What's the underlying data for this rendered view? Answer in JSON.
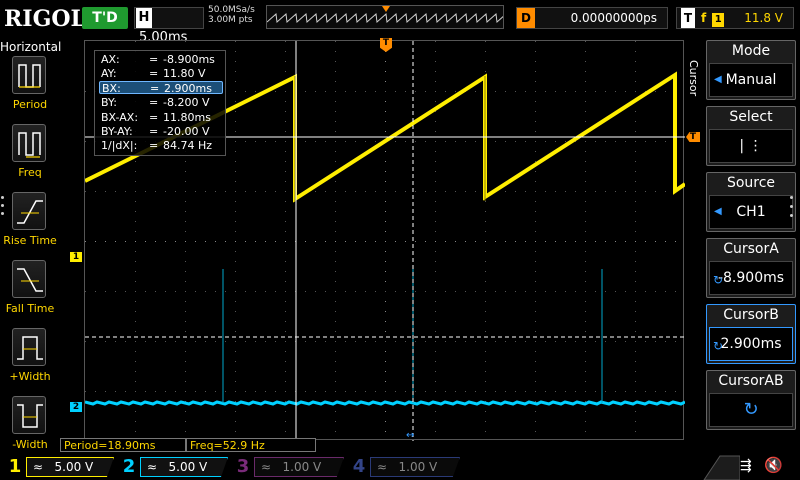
{
  "topbar": {
    "brand": "RIGOL",
    "run_state": "T'D",
    "timebase_label": "H",
    "timebase_value": "5.00ms",
    "sample_rate": "50.0MSa/s",
    "memory_depth": "3.00M pts",
    "trigger_position_marker": "T",
    "delay_label": "D",
    "delay_value": "0.00000000ps",
    "trigger_label": "T",
    "trigger_edge": "f",
    "trigger_source": "1",
    "trigger_level": "11.8 V"
  },
  "left_menu": {
    "title": "Horizontal",
    "items": [
      {
        "label": "Period"
      },
      {
        "label": "Freq"
      },
      {
        "label": "Rise Time"
      },
      {
        "label": "Fall Time"
      },
      {
        "label": "+Width"
      },
      {
        "label": "-Width"
      }
    ]
  },
  "right_menu": {
    "vertical_label": "Cursor",
    "mode_title": "Mode",
    "mode_value": "Manual",
    "select_title": "Select",
    "select_value": "| ⋮",
    "source_title": "Source",
    "source_value": "CH1",
    "cursor_a_title": "CursorA",
    "cursor_a_value": "-8.900ms",
    "cursor_b_title": "CursorB",
    "cursor_b_value": "2.900ms",
    "cursor_ab_title": "CursorAB",
    "knob_icon": "rotary-knob-icon",
    "arrow_icon": "left-arrow-icon"
  },
  "readout": [
    {
      "k": "AX:",
      "v": "-8.900ms"
    },
    {
      "k": "AY:",
      "v": "11.80 V"
    },
    {
      "k": "BX:",
      "v": "2.900ms"
    },
    {
      "k": "BY:",
      "v": "-8.200 V"
    },
    {
      "k": "BX-AX:",
      "v": "11.80ms"
    },
    {
      "k": "BY-AY:",
      "v": "-20.00 V"
    },
    {
      "k": "1/|dX|:",
      "v": "84.74 Hz"
    }
  ],
  "readout_eq": "=",
  "markers": {
    "ch1": "1",
    "ch2": "2",
    "trigger_level": "T",
    "cursor_b": "↔"
  },
  "measurements": {
    "period": "Period=18.90ms",
    "freq": "Freq=52.9 Hz"
  },
  "channels": [
    {
      "num": "1",
      "scale": "5.00 V",
      "color": "#ffee00",
      "active": true
    },
    {
      "num": "2",
      "scale": "5.00 V",
      "color": "#00d0ff",
      "active": true
    },
    {
      "num": "3",
      "scale": "1.00 V",
      "color": "#c43ec4",
      "active": false
    },
    {
      "num": "4",
      "scale": "1.00 V",
      "color": "#3355ff",
      "active": false
    }
  ],
  "status_icons": {
    "usb": "usb-icon",
    "sound": "speaker-muted-icon"
  },
  "colors": {
    "ch1": "#ffee00",
    "ch2": "#00d0ff",
    "ch3": "#c43ec4",
    "ch4": "#3355ff",
    "trigger": "#ff8c00",
    "menu_accent": "#3399ff"
  }
}
